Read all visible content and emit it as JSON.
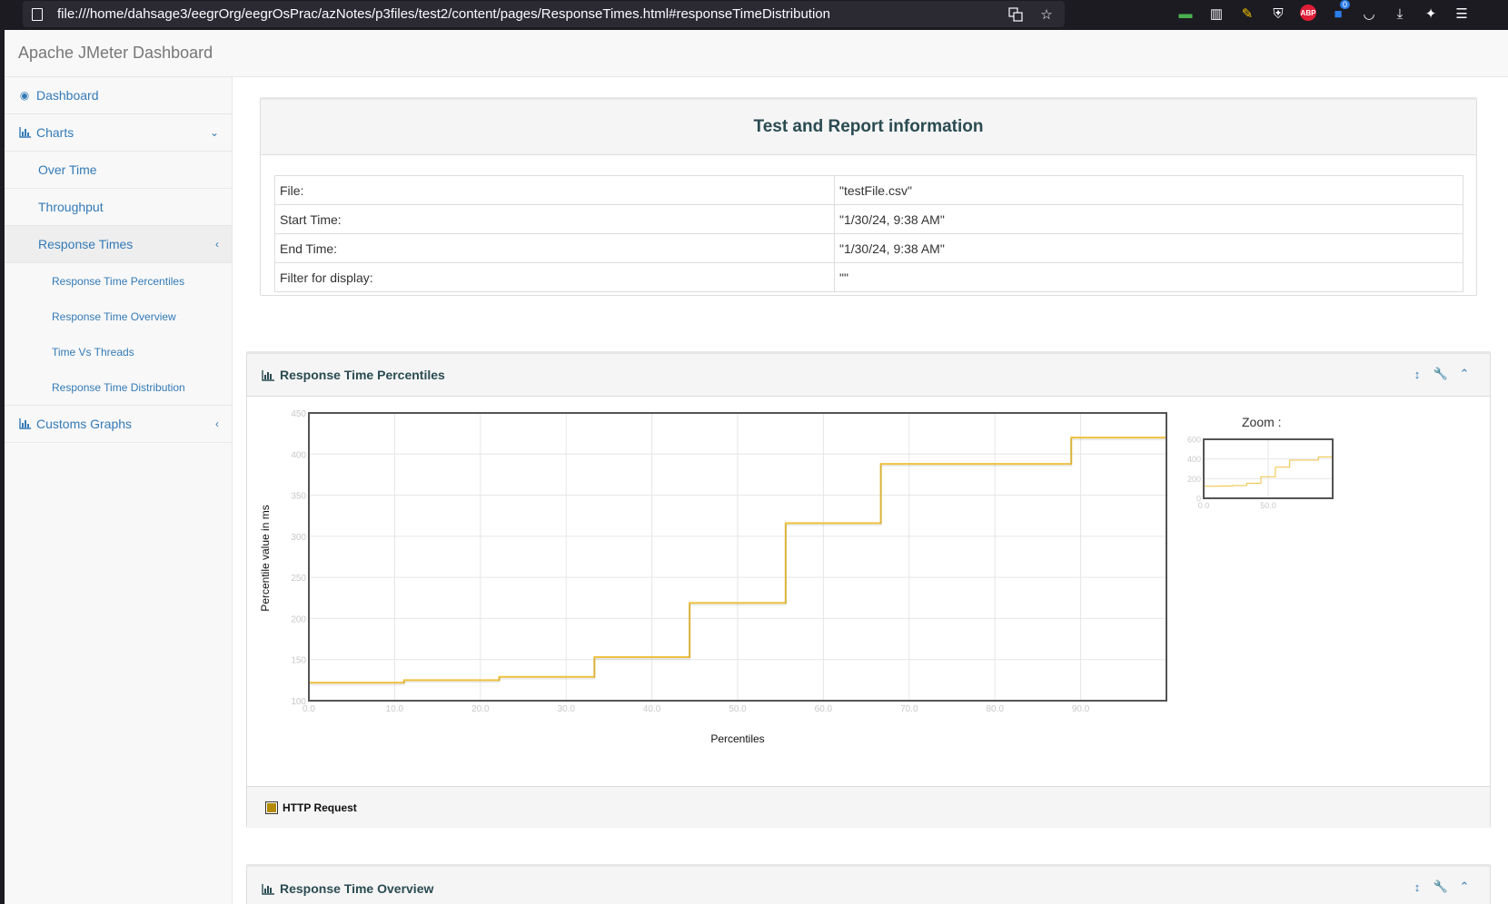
{
  "browser": {
    "url": "file:///home/dahsage3/eegrOrg/eegrOsPrac/azNotes/p3files/test2/content/pages/ResponseTimes.html#responseTimeDistribution",
    "extension_badge_count": "0",
    "abp_label": "ABP"
  },
  "brand": "Apache JMeter Dashboard",
  "sidebar": {
    "dashboard": "Dashboard",
    "charts": "Charts",
    "over_time": "Over Time",
    "throughput": "Throughput",
    "response_times": "Response Times",
    "sub_items": [
      "Response Time Percentiles",
      "Response Time Overview",
      "Time Vs Threads",
      "Response Time Distribution"
    ],
    "custom_graphs": "Customs Graphs"
  },
  "info": {
    "title": "Test and Report information",
    "rows": [
      {
        "label": "File:",
        "value": "\"testFile.csv\""
      },
      {
        "label": "Start Time:",
        "value": "\"1/30/24, 9:38 AM\""
      },
      {
        "label": "End Time:",
        "value": "\"1/30/24, 9:38 AM\""
      },
      {
        "label": "Filter for display:",
        "value": "\"\""
      }
    ]
  },
  "percentiles_panel": {
    "title": "Response Time Percentiles",
    "zoom_label": "Zoom :",
    "legend": "HTTP Request"
  },
  "overview_panel": {
    "title": "Response Time Overview"
  },
  "colors": {
    "series": "#edc240",
    "legend_swatch": "#b58b00",
    "link": "#337ab7"
  },
  "chart_data": [
    {
      "type": "line",
      "subtype": "step",
      "xlabel": "Percentiles",
      "ylabel": "Percentile value in ms",
      "xlim": [
        0,
        100
      ],
      "ylim": [
        100,
        450
      ],
      "xticks": [
        "0.0",
        "10.0",
        "20.0",
        "30.0",
        "40.0",
        "50.0",
        "60.0",
        "70.0",
        "80.0",
        "90.0"
      ],
      "yticks": [
        "100",
        "150",
        "200",
        "250",
        "300",
        "350",
        "400",
        "450"
      ],
      "grid": true,
      "series": [
        {
          "name": "HTTP Request",
          "x": [
            0,
            11.1,
            11.1,
            22.2,
            22.2,
            33.3,
            33.3,
            44.4,
            44.4,
            55.6,
            55.6,
            66.7,
            66.7,
            88.9,
            88.9,
            100
          ],
          "y": [
            122,
            122,
            125,
            125,
            129,
            129,
            153,
            153,
            219,
            219,
            316,
            316,
            388,
            388,
            420,
            420
          ]
        }
      ]
    },
    {
      "type": "line",
      "subtype": "step",
      "role": "zoom-overview",
      "xlim": [
        0,
        100
      ],
      "ylim": [
        0,
        600
      ],
      "xticks": [
        "0.0",
        "50.0"
      ],
      "yticks": [
        "0",
        "200",
        "400",
        "600"
      ],
      "grid": true,
      "series": [
        {
          "name": "HTTP Request",
          "x": [
            0,
            11.1,
            11.1,
            22.2,
            22.2,
            33.3,
            33.3,
            44.4,
            44.4,
            55.6,
            55.6,
            66.7,
            66.7,
            88.9,
            88.9,
            100
          ],
          "y": [
            122,
            122,
            125,
            125,
            129,
            129,
            153,
            153,
            219,
            219,
            316,
            316,
            388,
            388,
            420,
            420
          ]
        }
      ]
    }
  ]
}
